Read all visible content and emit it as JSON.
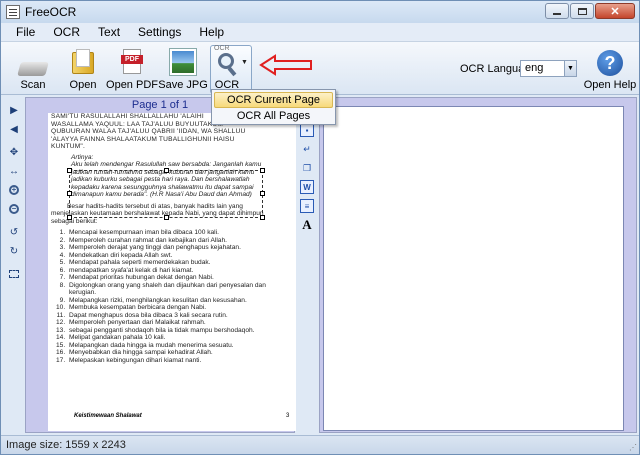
{
  "window": {
    "title": "FreeOCR",
    "controls": [
      "minimize",
      "maximize",
      "close"
    ]
  },
  "menu": [
    "File",
    "OCR",
    "Text",
    "Settings",
    "Help"
  ],
  "toolbar": {
    "scan_label": "Scan",
    "open_label": "Open",
    "open_pdf_label": "Open PDF",
    "pdf_badge": "PDF",
    "save_jpg_label": "Save JPG",
    "ocr_label": "OCR",
    "ocr_icon_text": "OCR",
    "ocr_language_label": "OCR Language:",
    "ocr_language_value": "eng",
    "open_help_label": "Open Help"
  },
  "ocr_menu": {
    "items": [
      "OCR Current Page",
      "OCR All Pages"
    ],
    "highlighted": "OCR Current Page"
  },
  "image_pane": {
    "page_indicator": "Page 1 of 1",
    "scan": {
      "header_lines": [
        "SAMI'TU RASULALLAHI SHALLALLAHU 'ALAIHI",
        "WASALLAMA YAQUUL: LAA TAJ'ALUU BUYUUTAKUM",
        "QUBUURAN WALAA TAJ'ALUU QABRII 'IIDAN, WA SHALLUU",
        "'ALAYYA FAINNA SHALAATAKUM TUBALLIGHUNII HAISU",
        "KUNTUM\"."
      ],
      "artinya_label": "Artinya:",
      "artinya_lines": [
        "Aku telah mendengar Rasulullah saw bersabda: Janganlah kamu",
        "jadikan rumah-rumahmu sebagai kuburan dan janganlah kamu",
        "jadikan kuburku sebagai pesta hari raya. Dan bershalawatlah",
        "kepadaku karena sesungguhnya shalawatmu itu dapat sampai",
        "dimanapun kamu berada\". (H.R Nasa'i  Abu Daud dan Ahmad)"
      ],
      "paragraph": "Besar hadits-hadits tersebut di atas, banyak hadits lain yang menjelaskan keutamaan bershalawat kepada Nabi, yang dapat dihimpun sebagai berikut:",
      "list": [
        "Mencapai kesempurnaan iman bila dibaca 100 kali.",
        "Memperoleh curahan rahmat dan kebajikan dari Allah.",
        "Memperoleh derajat yang tinggi dan penghapus kejahatan.",
        "Mendekatkan diri kepada Allah swt.",
        "Mendapat pahala seperti memerdekakan budak.",
        "mendapatkan syafa'at kelak di hari kiamat.",
        "Mendapat prioritas hubungan dekat dengan Nabi.",
        "Digolongkan orang yang shaleh dan dijauhkan dari penyesalan dan kerugian.",
        "Melapangkan rizki, menghilangkan kesulitan dan kesusahan.",
        "Membuka kesempatan berbicara dengan Nabi.",
        "Dapat menghapus dosa bila dibaca 3 kali secara rutin.",
        "Memperoleh penyertaan dari Malaikat rahmah.",
        "sebagai pengganti shodaqoh bila ia tidak mampu bershodaqoh.",
        "Melipat gandakan pahala 10 kali.",
        "Melapangkan dada hingga ia mudah menerima sesuatu.",
        "Menyebabkan dia hingga sampai kehadirat Allah.",
        "Melepaskan kebingungan dihari kiamat nanti."
      ],
      "footer_left": "Keistimewaan Shalawat",
      "footer_right": "3"
    }
  },
  "statusbar": {
    "text": "Image size: 1559 x 2243"
  },
  "colors": {
    "pane_background": "#c7c8ec",
    "highlight": "#f7d97a",
    "annotation_arrow": "#e02020"
  }
}
